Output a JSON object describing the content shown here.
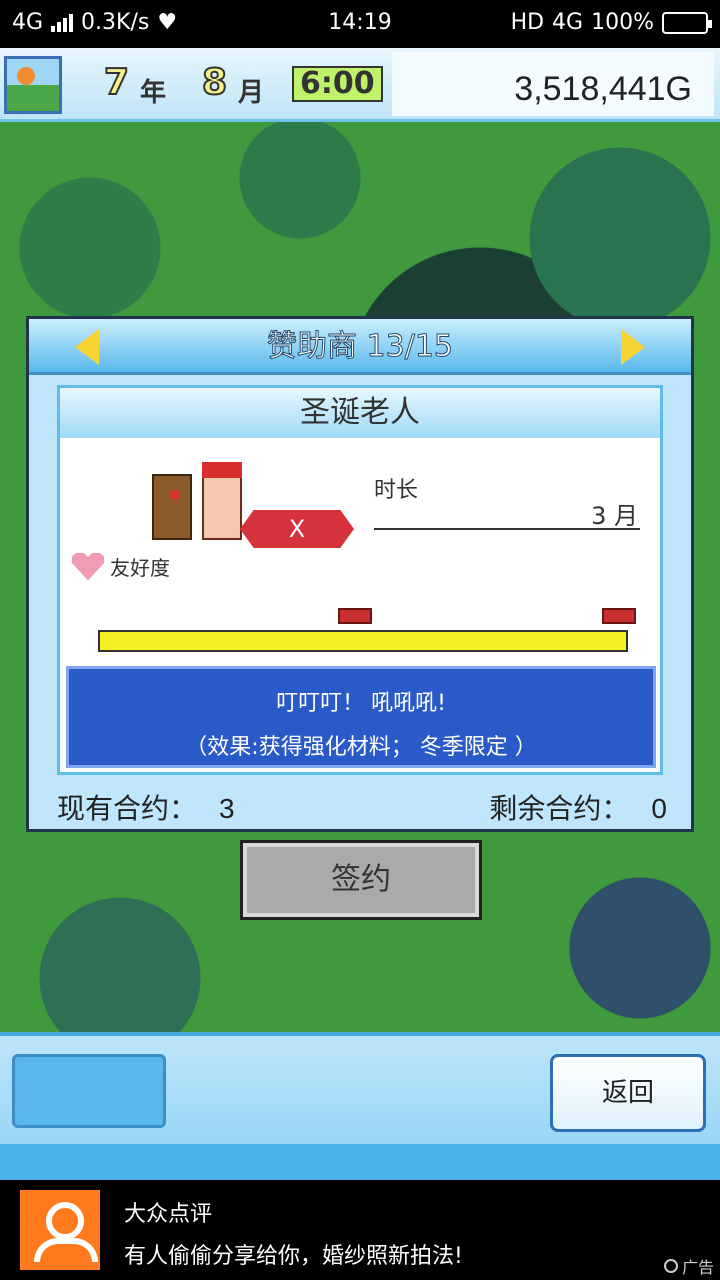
{
  "status_bar": {
    "network": "4G",
    "speed": "0.3K/s",
    "time": "14:19",
    "hd_label": "HD",
    "network_right": "4G",
    "battery": "100%"
  },
  "header": {
    "year_value": "7",
    "year_unit": "年",
    "month_value": "8",
    "month_unit": "月",
    "time": "6:00",
    "money": "3,518,441G"
  },
  "dialog": {
    "title": "赞助商 13/15",
    "sponsor_name": "圣诞老人",
    "x_label": "X",
    "duration_label": "时长",
    "duration_value": "3 月",
    "friendship_label": "友好度",
    "friendship_progress": 1.0,
    "description_line1": "叮叮叮！ 吼吼吼!",
    "description_line2": "（效果:获得强化材料； 冬季限定 ）",
    "current_contracts_label": "现有合约：",
    "current_contracts_value": "3",
    "remaining_contracts_label": "剩余合约：",
    "remaining_contracts_value": "0"
  },
  "actions": {
    "sign_label": "签约",
    "back_label": "返回"
  },
  "ad": {
    "title": "大众点评",
    "text": "有人偷偷分享给你，婚纱照新拍法!",
    "tag": "广告"
  },
  "colors": {
    "dialog_blue": "#59b9ec",
    "description_bg": "#2a59c8",
    "progress_yellow": "#f3ef23",
    "x_tag_red": "#d5323b"
  },
  "icons": [
    "wifi-shield-icon",
    "signal-icon",
    "battery-icon",
    "avatar-icon",
    "arrow-left-icon",
    "arrow-right-icon",
    "heart-icon",
    "reindeer-sprite",
    "santa-sprite",
    "ad-logo-icon"
  ]
}
